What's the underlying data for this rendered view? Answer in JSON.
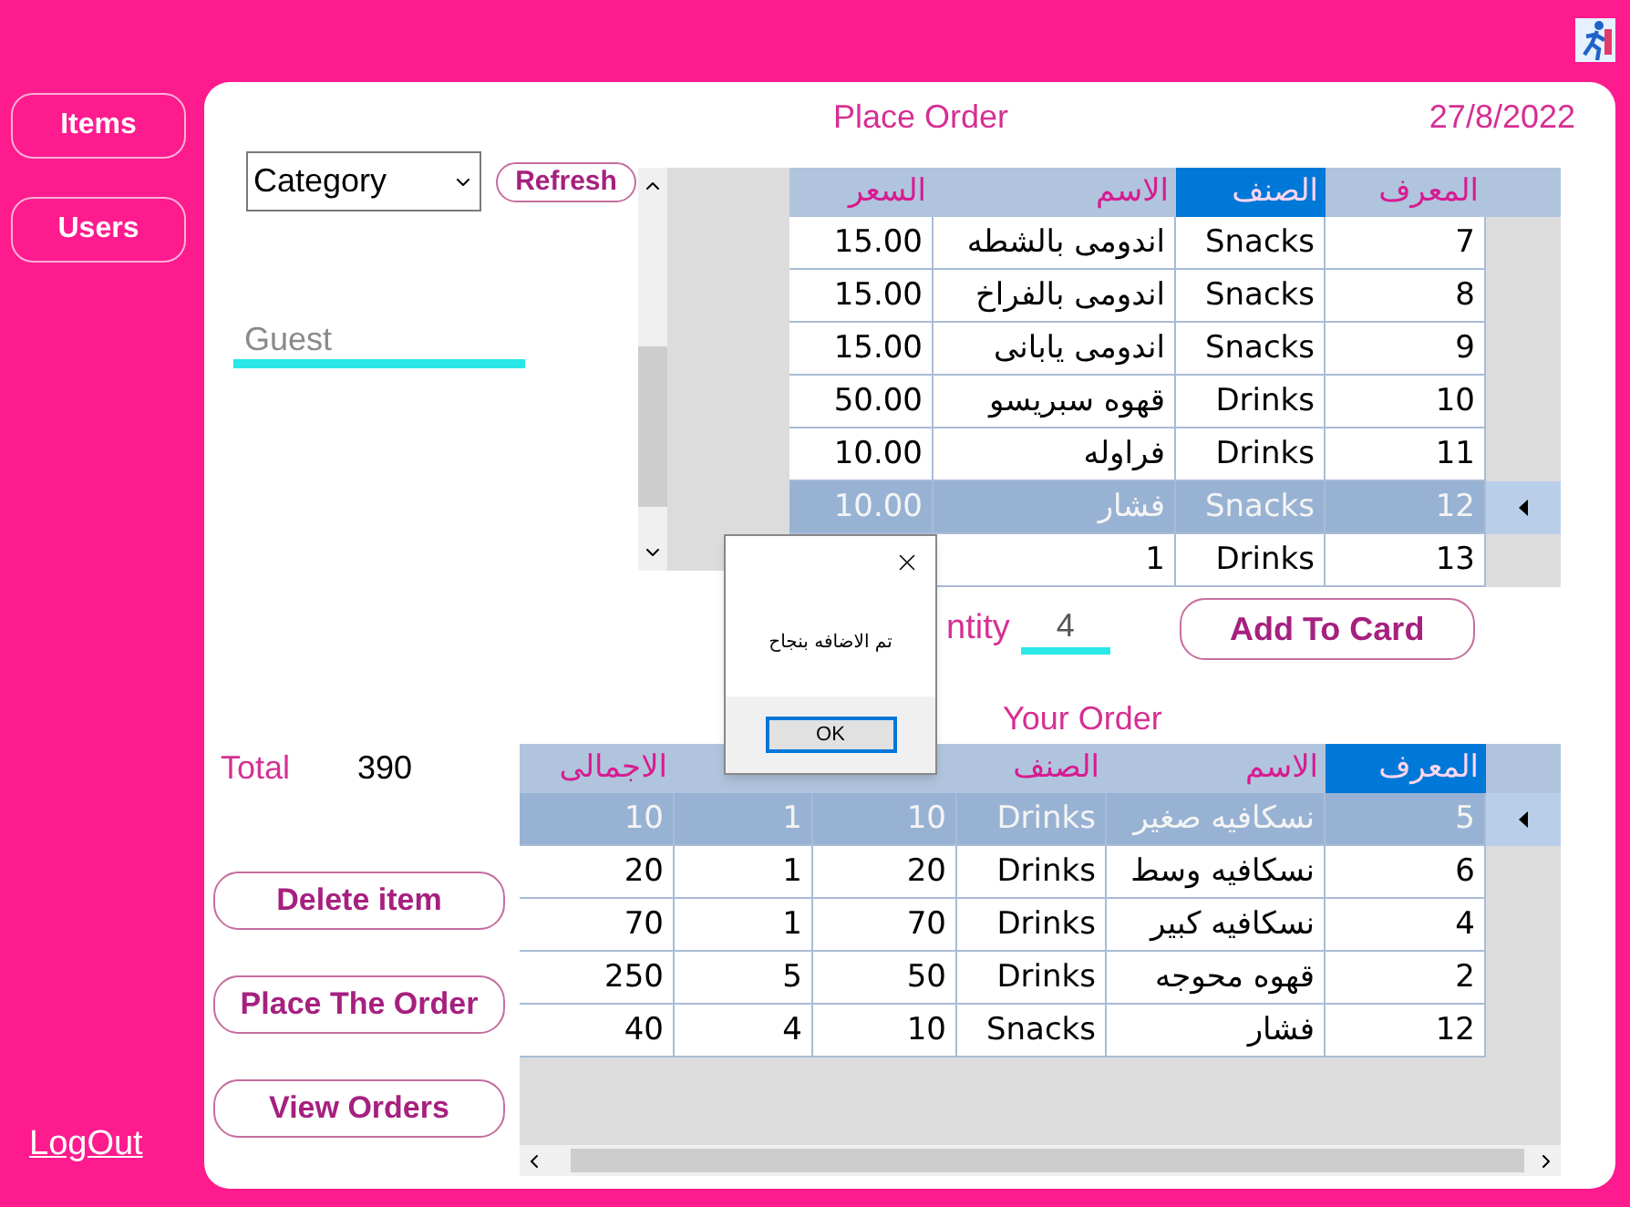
{
  "sidebar": {
    "items": [
      {
        "label": "Items"
      },
      {
        "label": "Users"
      }
    ],
    "logout": "LogOut"
  },
  "header": {
    "title": "Place Order",
    "date": "27/8/2022"
  },
  "category_select": {
    "value": "Category"
  },
  "refresh_button": "Refresh",
  "customer_field": {
    "placeholder": "Guest"
  },
  "items_table": {
    "columns": [
      {
        "label": "المعرف",
        "selected": false
      },
      {
        "label": "الصنف",
        "selected": true
      },
      {
        "label": "الاسم",
        "selected": false
      },
      {
        "label": "السعر",
        "selected": false
      }
    ],
    "rows": [
      {
        "cells": [
          "7",
          "Snacks",
          "اندومى بالشطه",
          "15.00"
        ],
        "selected": false
      },
      {
        "cells": [
          "8",
          "Snacks",
          "اندومى بالفراخ",
          "15.00"
        ],
        "selected": false
      },
      {
        "cells": [
          "9",
          "Snacks",
          "اندومى يابانى",
          "15.00"
        ],
        "selected": false
      },
      {
        "cells": [
          "10",
          "Drinks",
          "قهوه سبريسو",
          "50.00"
        ],
        "selected": false
      },
      {
        "cells": [
          "11",
          "Drinks",
          "فراوله",
          "10.00"
        ],
        "selected": false
      },
      {
        "cells": [
          "12",
          "Snacks",
          "فشار",
          "10.00"
        ],
        "selected": true
      },
      {
        "cells": [
          "13",
          "Drinks",
          "1"
        ],
        "selected": false
      }
    ]
  },
  "quantity": {
    "label": "ntity",
    "value": "4"
  },
  "add_button": "Add To Card",
  "order_title": "Your Order",
  "total": {
    "label": "Total",
    "value": "390"
  },
  "actions": [
    "Delete item",
    "Place The Order",
    "View Orders"
  ],
  "order_table": {
    "columns": [
      {
        "label": "المعرف",
        "selected": true
      },
      {
        "label": "الاسم",
        "selected": false
      },
      {
        "label": "الصنف",
        "selected": false
      },
      {
        "selected": false
      },
      {
        "selected": false
      },
      {
        "label": "الاجمالى",
        "selected": false
      }
    ],
    "rows": [
      {
        "cells": [
          "5",
          "نسكافيه صغير",
          "Drinks",
          "10",
          "1",
          "10"
        ],
        "selected": true
      },
      {
        "cells": [
          "6",
          "نسكافيه وسط",
          "Drinks",
          "20",
          "1",
          "20"
        ],
        "selected": false
      },
      {
        "cells": [
          "4",
          "نسكافيه كبير",
          "Drinks",
          "70",
          "1",
          "70"
        ],
        "selected": false
      },
      {
        "cells": [
          "2",
          "قهوه محوجه",
          "Drinks",
          "50",
          "5",
          "250"
        ],
        "selected": false
      },
      {
        "cells": [
          "12",
          "فشار",
          "Snacks",
          "10",
          "4",
          "40"
        ],
        "selected": false
      }
    ]
  },
  "dialog": {
    "message": "تم الاضافه بنجاح",
    "button": "OK"
  }
}
